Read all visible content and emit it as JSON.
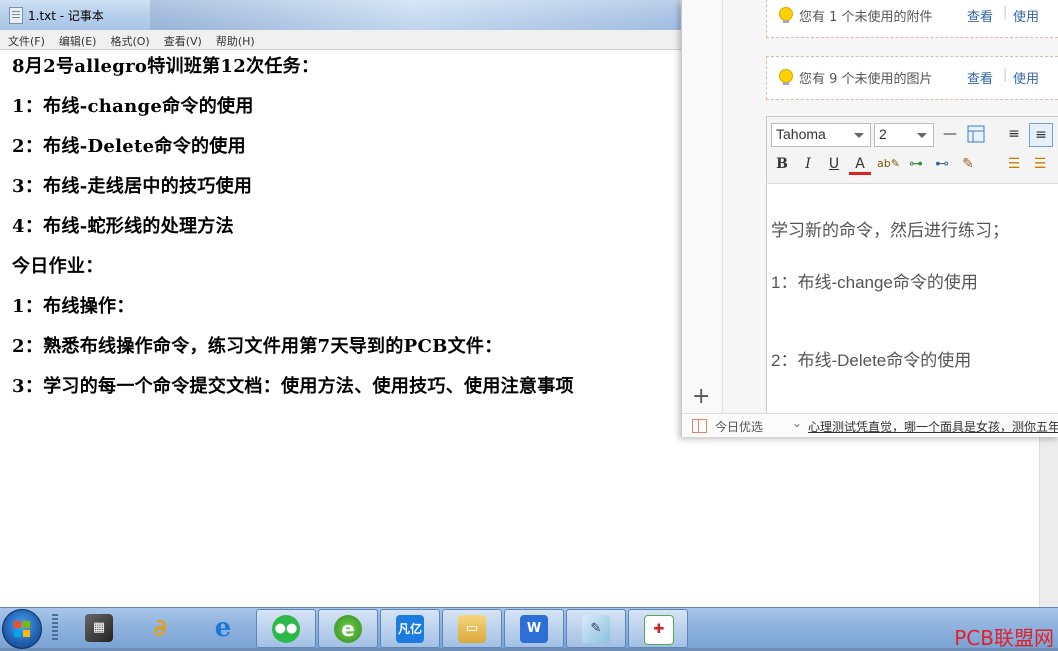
{
  "notepad": {
    "title": "1.txt - 记事本",
    "menu": [
      "文件(F)",
      "编辑(E)",
      "格式(O)",
      "查看(V)",
      "帮助(H)"
    ],
    "lines": [
      "8月2号allegro特训班第12次任务：",
      "1：布线-change命令的使用",
      "2：布线-Delete命令的使用",
      "3：布线-走线居中的技巧使用",
      "4：布线-蛇形线的处理方法",
      "今日作业：",
      "1：布线操作：",
      "2：熟悉布线操作命令，练习文件用第7天导到的PCB文件：",
      "3：学习的每一个命令提交文档：使用方法、使用技巧、使用注意事项"
    ]
  },
  "mail": {
    "attachments_notice": "您有 1 个未使用的附件",
    "images_notice": "您有 9 个未使用的图片",
    "view_label": "查看",
    "use_label": "使用",
    "font_family": "Tahoma",
    "font_size": "2",
    "toolbar_icons": [
      "hr-icon",
      "table-icon",
      "align-right-icon",
      "align-left-icon",
      "bold-icon",
      "italic-icon",
      "underline-icon",
      "font-color-icon",
      "highlight-icon",
      "link-icon",
      "unlink-icon",
      "clear-format-icon",
      "list-icon",
      "list2-icon"
    ],
    "body_lines": [
      "学习新的命令，然后进行练习；",
      "1：布线-change命令的使用",
      "2：布线-Delete命令的使用"
    ],
    "footer_label": "今日优选",
    "footer_ad": "心理测试凭直觉，哪一个面具是女孩，测你五年"
  },
  "taskbar": {
    "apps": [
      "start-orb",
      "media-app",
      "qq-app",
      "ie-browser",
      "wechat",
      "360-browser",
      "fanyi-app",
      "file-explorer",
      "wps-app",
      "notepad-app",
      "pcb-app"
    ],
    "fanyi_text": "凡亿",
    "watermark": "PCB联盟网"
  }
}
